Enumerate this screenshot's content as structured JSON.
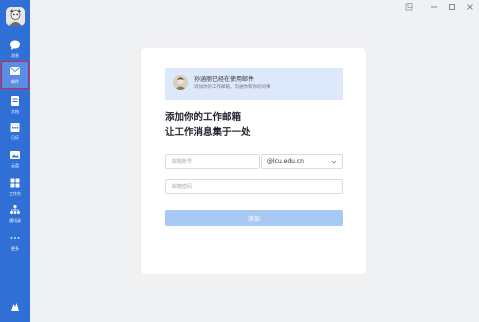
{
  "sidebar": {
    "items": [
      {
        "label": "消息",
        "icon": "chat-bubble-icon"
      },
      {
        "label": "邮件",
        "icon": "mail-icon",
        "active": true
      },
      {
        "label": "文档",
        "icon": "document-icon"
      },
      {
        "label": "日历",
        "icon": "calendar-icon"
      },
      {
        "label": "云盘",
        "icon": "cloud-drive-icon"
      },
      {
        "label": "工作台",
        "icon": "workbench-grid-icon"
      },
      {
        "label": "通讯录",
        "icon": "contacts-icon"
      },
      {
        "label": "更多",
        "icon": "more-dots-icon"
      }
    ],
    "bottom_icon": "app-logo-icon"
  },
  "window_controls": [
    "pin-icon",
    "minimize-icon",
    "maximize-icon",
    "close-icon"
  ],
  "card": {
    "banner": {
      "title": "孙涵丽已经在使用邮件",
      "subtitle": "添加你的工作邮箱，沟通你和你的同事"
    },
    "headline_line1": "添加你的工作邮箱",
    "headline_line2": "让工作消息集于一处",
    "account_placeholder": "邮箱账号",
    "domain_value": "@lcu.edu.cn",
    "password_placeholder": "邮箱密码",
    "add_button": "添加"
  },
  "colors": {
    "sidebar": "#2f6fd6",
    "active_outline": "#e0242b",
    "button_disabled": "#a9c9f5",
    "banner_bg": "#dde9fb"
  }
}
